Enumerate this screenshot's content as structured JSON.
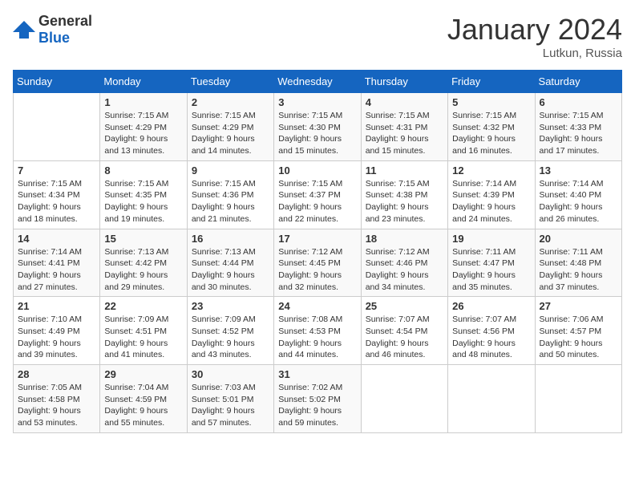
{
  "logo": {
    "general": "General",
    "blue": "Blue"
  },
  "header": {
    "month": "January 2024",
    "location": "Lutkun, Russia"
  },
  "weekdays": [
    "Sunday",
    "Monday",
    "Tuesday",
    "Wednesday",
    "Thursday",
    "Friday",
    "Saturday"
  ],
  "weeks": [
    [
      {
        "day": null
      },
      {
        "day": 1,
        "sunrise": "7:15 AM",
        "sunset": "4:29 PM",
        "daylight": "9 hours and 13 minutes."
      },
      {
        "day": 2,
        "sunrise": "7:15 AM",
        "sunset": "4:29 PM",
        "daylight": "9 hours and 14 minutes."
      },
      {
        "day": 3,
        "sunrise": "7:15 AM",
        "sunset": "4:30 PM",
        "daylight": "9 hours and 15 minutes."
      },
      {
        "day": 4,
        "sunrise": "7:15 AM",
        "sunset": "4:31 PM",
        "daylight": "9 hours and 15 minutes."
      },
      {
        "day": 5,
        "sunrise": "7:15 AM",
        "sunset": "4:32 PM",
        "daylight": "9 hours and 16 minutes."
      },
      {
        "day": 6,
        "sunrise": "7:15 AM",
        "sunset": "4:33 PM",
        "daylight": "9 hours and 17 minutes."
      }
    ],
    [
      {
        "day": 7,
        "sunrise": "7:15 AM",
        "sunset": "4:34 PM",
        "daylight": "9 hours and 18 minutes."
      },
      {
        "day": 8,
        "sunrise": "7:15 AM",
        "sunset": "4:35 PM",
        "daylight": "9 hours and 19 minutes."
      },
      {
        "day": 9,
        "sunrise": "7:15 AM",
        "sunset": "4:36 PM",
        "daylight": "9 hours and 21 minutes."
      },
      {
        "day": 10,
        "sunrise": "7:15 AM",
        "sunset": "4:37 PM",
        "daylight": "9 hours and 22 minutes."
      },
      {
        "day": 11,
        "sunrise": "7:15 AM",
        "sunset": "4:38 PM",
        "daylight": "9 hours and 23 minutes."
      },
      {
        "day": 12,
        "sunrise": "7:14 AM",
        "sunset": "4:39 PM",
        "daylight": "9 hours and 24 minutes."
      },
      {
        "day": 13,
        "sunrise": "7:14 AM",
        "sunset": "4:40 PM",
        "daylight": "9 hours and 26 minutes."
      }
    ],
    [
      {
        "day": 14,
        "sunrise": "7:14 AM",
        "sunset": "4:41 PM",
        "daylight": "9 hours and 27 minutes."
      },
      {
        "day": 15,
        "sunrise": "7:13 AM",
        "sunset": "4:42 PM",
        "daylight": "9 hours and 29 minutes."
      },
      {
        "day": 16,
        "sunrise": "7:13 AM",
        "sunset": "4:44 PM",
        "daylight": "9 hours and 30 minutes."
      },
      {
        "day": 17,
        "sunrise": "7:12 AM",
        "sunset": "4:45 PM",
        "daylight": "9 hours and 32 minutes."
      },
      {
        "day": 18,
        "sunrise": "7:12 AM",
        "sunset": "4:46 PM",
        "daylight": "9 hours and 34 minutes."
      },
      {
        "day": 19,
        "sunrise": "7:11 AM",
        "sunset": "4:47 PM",
        "daylight": "9 hours and 35 minutes."
      },
      {
        "day": 20,
        "sunrise": "7:11 AM",
        "sunset": "4:48 PM",
        "daylight": "9 hours and 37 minutes."
      }
    ],
    [
      {
        "day": 21,
        "sunrise": "7:10 AM",
        "sunset": "4:49 PM",
        "daylight": "9 hours and 39 minutes."
      },
      {
        "day": 22,
        "sunrise": "7:09 AM",
        "sunset": "4:51 PM",
        "daylight": "9 hours and 41 minutes."
      },
      {
        "day": 23,
        "sunrise": "7:09 AM",
        "sunset": "4:52 PM",
        "daylight": "9 hours and 43 minutes."
      },
      {
        "day": 24,
        "sunrise": "7:08 AM",
        "sunset": "4:53 PM",
        "daylight": "9 hours and 44 minutes."
      },
      {
        "day": 25,
        "sunrise": "7:07 AM",
        "sunset": "4:54 PM",
        "daylight": "9 hours and 46 minutes."
      },
      {
        "day": 26,
        "sunrise": "7:07 AM",
        "sunset": "4:56 PM",
        "daylight": "9 hours and 48 minutes."
      },
      {
        "day": 27,
        "sunrise": "7:06 AM",
        "sunset": "4:57 PM",
        "daylight": "9 hours and 50 minutes."
      }
    ],
    [
      {
        "day": 28,
        "sunrise": "7:05 AM",
        "sunset": "4:58 PM",
        "daylight": "9 hours and 53 minutes."
      },
      {
        "day": 29,
        "sunrise": "7:04 AM",
        "sunset": "4:59 PM",
        "daylight": "9 hours and 55 minutes."
      },
      {
        "day": 30,
        "sunrise": "7:03 AM",
        "sunset": "5:01 PM",
        "daylight": "9 hours and 57 minutes."
      },
      {
        "day": 31,
        "sunrise": "7:02 AM",
        "sunset": "5:02 PM",
        "daylight": "9 hours and 59 minutes."
      },
      {
        "day": null
      },
      {
        "day": null
      },
      {
        "day": null
      }
    ]
  ],
  "labels": {
    "sunrise_prefix": "Sunrise: ",
    "sunset_prefix": "Sunset: ",
    "daylight_prefix": "Daylight: "
  }
}
